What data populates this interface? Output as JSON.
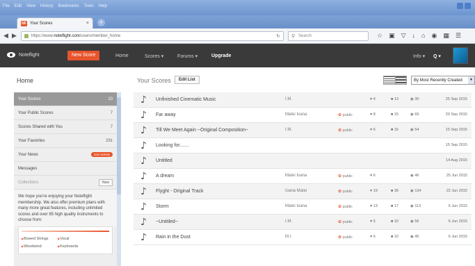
{
  "browser": {
    "menus": [
      "File",
      "Edit",
      "View",
      "History",
      "Bookmarks",
      "Tools",
      "Help"
    ],
    "tab_title": "Your Scores",
    "tab_favicon": "NF",
    "url_prefix": "https://www.",
    "url_domain": "noteflight.com",
    "url_path": "/users/member_home",
    "search_placeholder": "Search"
  },
  "site": {
    "logo": "Noteflight",
    "new_score": "New Score",
    "nav": {
      "home": "Home",
      "scores": "Scores ▾",
      "forums": "Forums ▾",
      "upgrade": "Upgrade",
      "info": "Info ▾",
      "search_icon": "Q ▾"
    }
  },
  "sidebar": {
    "title": "Home",
    "items": [
      {
        "label": "Your Scores",
        "count": "10"
      },
      {
        "label": "Your Public Scores",
        "count": "7"
      },
      {
        "label": "Scores Shared with You",
        "count": "7"
      },
      {
        "label": "Your Favorites",
        "count": "291"
      },
      {
        "label": "Your News",
        "badge": "new activity"
      },
      {
        "label": "Messages"
      },
      {
        "label": "Collections",
        "new": "New"
      }
    ],
    "promo": "We hope you're enjoying your Noteflight membership. We also offer premium plans with many more great features, including unlimited scores and over 85 high quality instruments to choose from:",
    "categories": [
      "Bowed Strings",
      "Vocal",
      "Woodwind",
      "Keyboards"
    ]
  },
  "main": {
    "title": "Your Scores",
    "edit_list": "Edit List",
    "sort": "By Most Recently Created",
    "public_label": "public",
    "scores": [
      {
        "title": "Unfinished Cinematic Music",
        "composer": "I.M.",
        "public": false,
        "likes": "4",
        "comments": "13",
        "views": "30",
        "date": "25 Sep 2015"
      },
      {
        "title": "Far away",
        "composer": "Matei Ioana",
        "public": true,
        "likes": "8",
        "comments": "15",
        "views": "69",
        "date": "20 Sep 2015"
      },
      {
        "title": "Till We Meet Again ~Original Composition~",
        "composer": "I.M.",
        "public": true,
        "likes": "6",
        "comments": "15",
        "views": "54",
        "date": "15 Sep 2015"
      },
      {
        "title": "Looking for.......",
        "composer": "",
        "public": false,
        "likes": "",
        "comments": "",
        "views": "",
        "date": "15 Sep 2015"
      },
      {
        "title": "Untitled",
        "composer": "",
        "public": false,
        "likes": "",
        "comments": "",
        "views": "",
        "date": "14 Aug 2015"
      },
      {
        "title": "A dream",
        "composer": "Matei Ioana",
        "public": true,
        "likes": "6",
        "comments": "",
        "views": "46",
        "date": "25 Jun 2015"
      },
      {
        "title": "Flyght - Original Track",
        "composer": "Ioana Matei",
        "public": true,
        "likes": "19",
        "comments": "39",
        "views": "134",
        "date": "22 Jun 2015"
      },
      {
        "title": "Storm",
        "composer": "Matei Ioana",
        "public": true,
        "likes": "13",
        "comments": "17",
        "views": "113",
        "date": "6 Jun 2015"
      },
      {
        "title": "~Untitled~",
        "composer": "I.M.",
        "public": true,
        "likes": "5",
        "comments": "10",
        "views": "56",
        "date": "6 Jun 2015"
      },
      {
        "title": "Rain in the Dust",
        "composer": "M.I.",
        "public": true,
        "likes": "6",
        "comments": "10",
        "views": "45",
        "date": "6 Jun 2015"
      }
    ]
  }
}
